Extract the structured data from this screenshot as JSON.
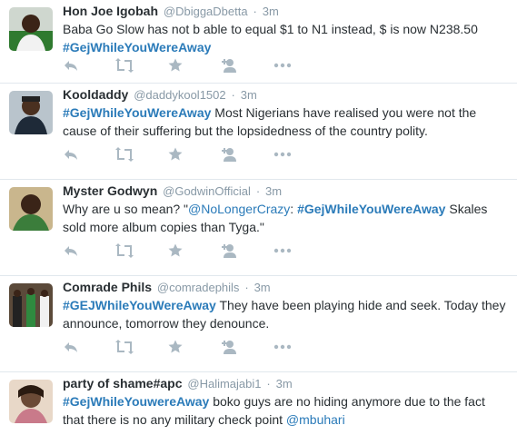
{
  "tweets": [
    {
      "fullname": "Hon Joe Igobah",
      "username": "@DbiggaDbetta",
      "time": "3m",
      "segments": [
        {
          "type": "text",
          "value": "Baba Go Slow has not b able to equal $1 to N1 instead, $ is now N238.50 "
        },
        {
          "type": "hashtag",
          "value": "#GejWhileYouWereAway"
        }
      ]
    },
    {
      "fullname": "Kooldaddy",
      "username": "@daddykool1502",
      "time": "3m",
      "segments": [
        {
          "type": "hashtag",
          "value": "#GejWhileYouWereAway"
        },
        {
          "type": "text",
          "value": " Most  Nigerians have realised you were not the cause of their suffering but the lopsidedness of the country polity."
        }
      ]
    },
    {
      "fullname": "Myster Godwyn",
      "username": "@GodwinOfficial",
      "time": "3m",
      "segments": [
        {
          "type": "text",
          "value": "Why are u so mean? \""
        },
        {
          "type": "mention",
          "value": "@NoLongerCrazy"
        },
        {
          "type": "text",
          "value": ": "
        },
        {
          "type": "hashtag",
          "value": "#GejWhileYouWereAway"
        },
        {
          "type": "text",
          "value": " Skales sold more album copies than Tyga.\""
        }
      ]
    },
    {
      "fullname": "Comrade Phils",
      "username": "@comradephils",
      "time": "3m",
      "segments": [
        {
          "type": "hashtag",
          "value": "#GEJWhileYouWereAway"
        },
        {
          "type": "text",
          "value": " They have been playing hide and seek. Today they announce, tomorrow they denounce."
        }
      ]
    },
    {
      "fullname": "party of shame#apc",
      "username": "@Halimajabi1",
      "time": "3m",
      "segments": [
        {
          "type": "hashtag",
          "value": "#GejWhileYouwereAway"
        },
        {
          "type": "text",
          "value": " boko guys are no hiding anymore due to the fact that there is no any military check point "
        },
        {
          "type": "mention",
          "value": "@mbuhari"
        }
      ]
    }
  ],
  "action_icons": [
    "reply-icon",
    "retweet-icon",
    "favorite-icon",
    "follow-icon",
    "more-icon"
  ],
  "colors": {
    "link": "#2b7bb9",
    "meta": "#8899a6",
    "icon": "#aab8c2",
    "divider": "#e1e8ed",
    "text": "#292f33"
  }
}
